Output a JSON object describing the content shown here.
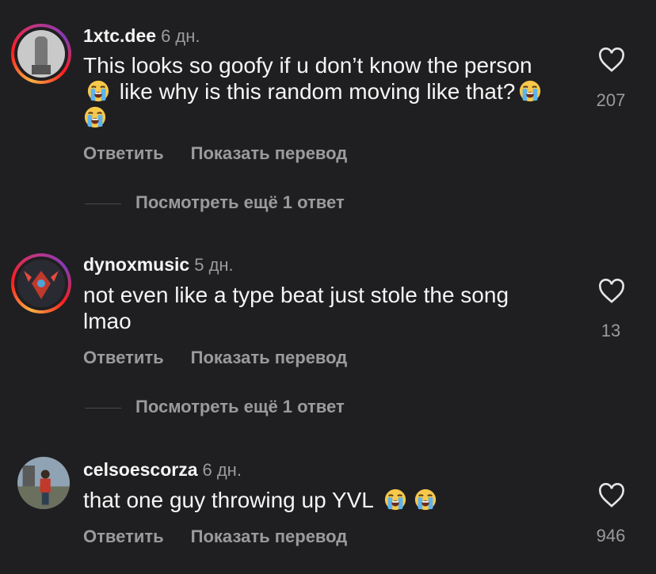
{
  "comments": [
    {
      "username": "1xtc.dee",
      "time": "6 дн.",
      "text_line1": "This looks so goofy if u don’t know the person",
      "text_line2": "like why is this random moving like that?",
      "likes": "207",
      "reply_label": "Ответить",
      "translate_label": "Показать перевод",
      "more_replies": "Посмотреть ещё 1 ответ"
    },
    {
      "username": "dynoxmusic",
      "time": "5 дн.",
      "text_line1": "not even like a type beat just stole the song",
      "text_line2": "lmao",
      "likes": "13",
      "reply_label": "Ответить",
      "translate_label": "Показать перевод",
      "more_replies": "Посмотреть ещё 1 ответ"
    },
    {
      "username": "celsoescorza",
      "time": "6 дн.",
      "text_line1": "that one guy throwing up YVL",
      "likes": "946",
      "reply_label": "Ответить",
      "translate_label": "Показать перевод"
    }
  ],
  "icons": {
    "like": "heart-icon",
    "emoji": "loudly-crying-face-emoji"
  },
  "colors": {
    "background": "#1f1f21",
    "muted": "#9b9b9e",
    "text": "#f5f5f5"
  }
}
